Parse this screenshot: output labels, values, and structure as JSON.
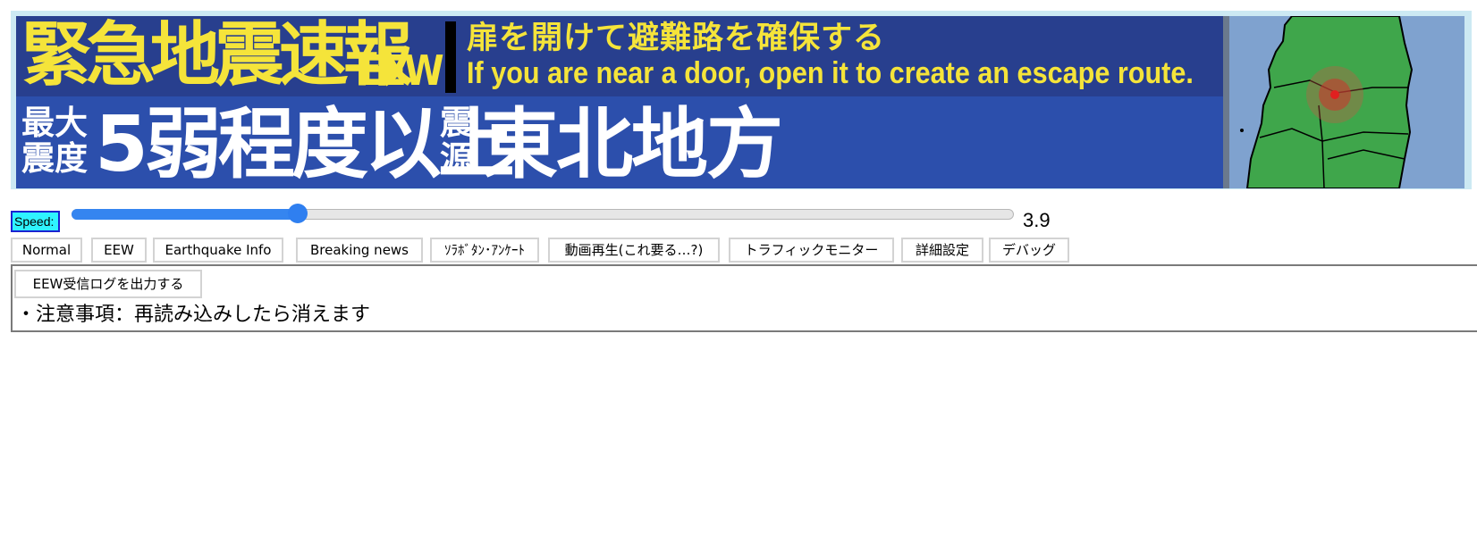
{
  "banner": {
    "title": "緊急地震速報",
    "title_abbr": "EEW",
    "instruction_ja": "扉を開けて避難路を確保する",
    "instruction_en": "If you are near a door, open it to create an escape route.",
    "max_intensity_label": "最大震度",
    "max_intensity_value": "5弱程度以上",
    "epicenter_label": "震源",
    "epicenter_value": "東北地方",
    "colors": {
      "top_band": "#283f8e",
      "bottom_band": "#2c4fac",
      "headline_text": "#f5e43a",
      "value_text": "#ffffff",
      "map_sea": "#7fa2cf",
      "map_land": "#3fa64b"
    },
    "map_icon": "tohoku-map-with-epicenter-marker"
  },
  "speed": {
    "label": "Speed:",
    "value": "3.9",
    "fraction": 0.24
  },
  "tabs": [
    {
      "label": "Normal"
    },
    {
      "label": "EEW"
    },
    {
      "label": "Earthquake Info"
    },
    {
      "label": "Breaking news"
    },
    {
      "label": "ｿﾗﾎﾞﾀﾝ･ｱﾝｹｰﾄ"
    },
    {
      "label": "動画再生(これ要る…?)"
    },
    {
      "label": "トラフィックモニター"
    },
    {
      "label": "詳細設定"
    },
    {
      "label": "デバッグ"
    }
  ],
  "panel": {
    "log_button_label": "EEW受信ログを出力する",
    "notice": "・注意事項：再読み込みしたら消えます"
  }
}
